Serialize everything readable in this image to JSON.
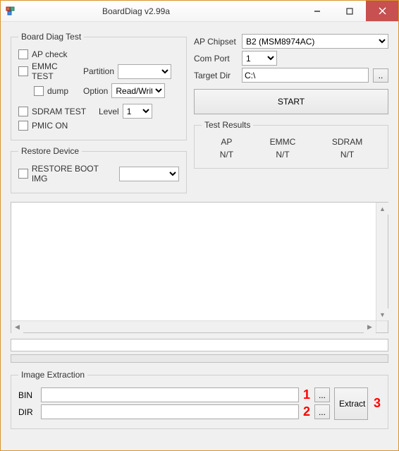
{
  "window": {
    "title": "BoardDiag v2.99a"
  },
  "boardDiag": {
    "legend": "Board Diag Test",
    "ap_check": "AP check",
    "emmc_test": "EMMC TEST",
    "partition_label": "Partition",
    "partition_value": "",
    "dump": "dump",
    "option_label": "Option",
    "option_value": "Read/Writ",
    "sdram_test": "SDRAM TEST",
    "level_label": "Level",
    "level_value": "1",
    "pmic_on": "PMIC ON"
  },
  "restore": {
    "legend": "Restore Device",
    "restore_boot": "RESTORE BOOT IMG",
    "restore_value": ""
  },
  "rightPanel": {
    "ap_chipset_label": "AP Chipset",
    "ap_chipset_value": "B2 (MSM8974AC)",
    "com_port_label": "Com Port",
    "com_port_value": "1",
    "target_dir_label": "Target Dir",
    "target_dir_value": "C:\\",
    "browse": "..",
    "start": "START"
  },
  "results": {
    "legend": "Test Results",
    "ap_label": "AP",
    "ap_value": "N/T",
    "emmc_label": "EMMC",
    "emmc_value": "N/T",
    "sdram_label": "SDRAM",
    "sdram_value": "N/T"
  },
  "imageExtraction": {
    "legend": "Image Extraction",
    "bin_label": "BIN",
    "bin_value": "",
    "dir_label": "DIR",
    "dir_value": "",
    "browse": "...",
    "extract": "Extract"
  },
  "annotations": {
    "num1": "1",
    "num2": "2",
    "num3": "3"
  }
}
